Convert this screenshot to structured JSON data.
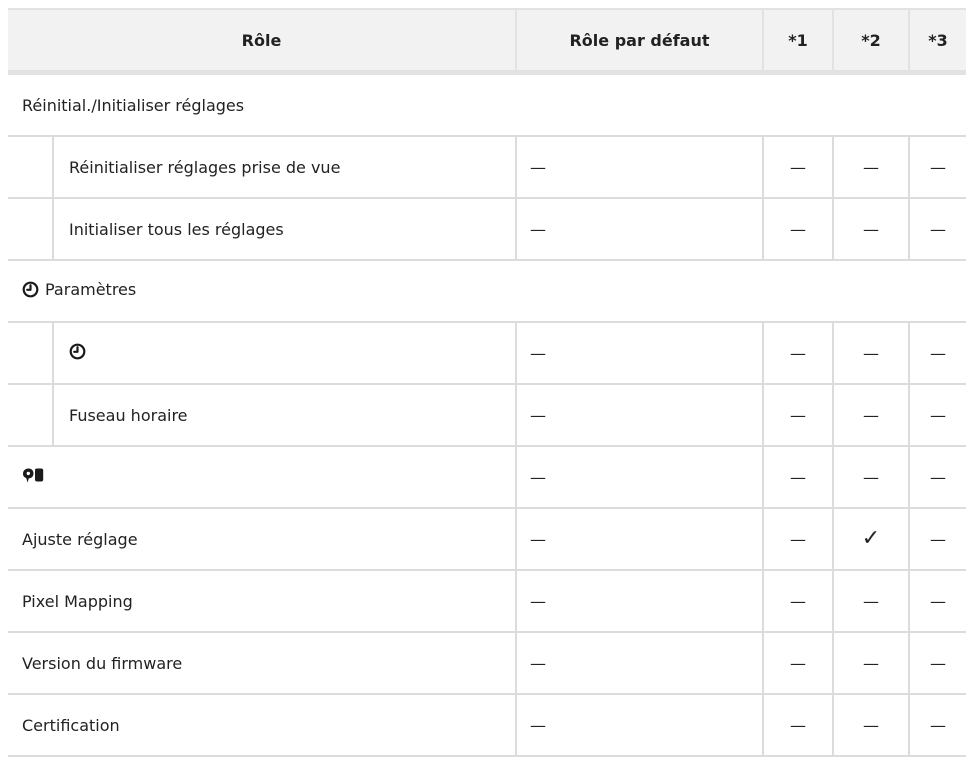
{
  "header": {
    "role": "Rôle",
    "default_role": "Rôle par défaut",
    "col1": "*1",
    "col2": "*2",
    "col3": "*3"
  },
  "rows": [
    {
      "label": "Réinitial./Initialiser réglages",
      "kind": "section"
    },
    {
      "label": "Réinitialiser réglages prise de vue",
      "kind": "sub",
      "values": [
        "—",
        "—",
        "—",
        "—"
      ]
    },
    {
      "label": "Initialiser tous les réglages",
      "kind": "sub",
      "values": [
        "—",
        "—",
        "—",
        "—"
      ]
    },
    {
      "label": "Paramètres",
      "kind": "section",
      "icon": "clock-icon"
    },
    {
      "label": "",
      "kind": "sub",
      "icon": "clock-icon",
      "values": [
        "—",
        "—",
        "—",
        "—"
      ]
    },
    {
      "label": "Fuseau horaire",
      "kind": "sub",
      "values": [
        "—",
        "—",
        "—",
        "—"
      ]
    },
    {
      "label": "",
      "kind": "item",
      "icon": "speech-bubbles-icon",
      "values": [
        "—",
        "—",
        "—",
        "—"
      ]
    },
    {
      "label": "Ajuste réglage",
      "kind": "item",
      "values": [
        "—",
        "—",
        "✓",
        "—"
      ]
    },
    {
      "label": "Pixel Mapping",
      "kind": "item",
      "values": [
        "—",
        "—",
        "—",
        "—"
      ]
    },
    {
      "label": "Version du firmware",
      "kind": "item",
      "values": [
        "—",
        "—",
        "—",
        "—"
      ]
    },
    {
      "label": "Certification",
      "kind": "item",
      "values": [
        "—",
        "—",
        "—",
        "—"
      ]
    }
  ]
}
